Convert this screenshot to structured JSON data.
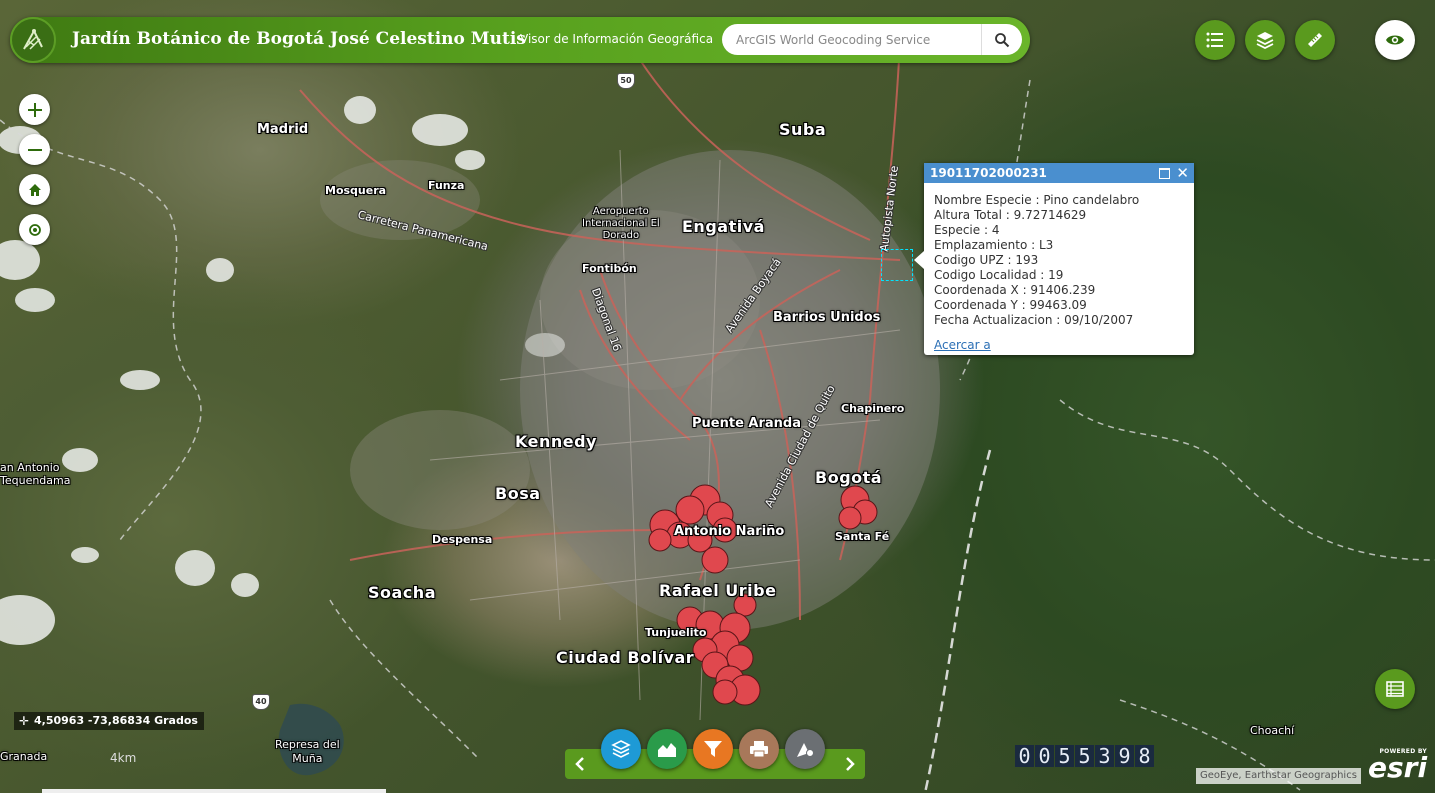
{
  "header": {
    "title": "Jardín Botánico de Bogotá José Celestino Mutis",
    "subtitle": "Visor de Información Geográfica",
    "search_placeholder": "ArcGIS World Geocoding Service"
  },
  "top_right_buttons": [
    "list-icon",
    "layers-icon",
    "measure-icon",
    "eye-icon"
  ],
  "map_controls": [
    "zoom-in",
    "zoom-out",
    "home",
    "locate"
  ],
  "place_labels": {
    "madrid": "Madrid",
    "suba": "Suba",
    "mosquera": "Mosquera",
    "funza": "Funza",
    "engativa": "Engativá",
    "aeropuerto": "Aeropuerto\nInternacional El\nDorado",
    "fontibon": "Fontibón",
    "barrios_unidos": "Barrios Unidos",
    "kennedy": "Kennedy",
    "puente_aranda": "Puente Aranda",
    "chapinero": "Chapinero",
    "bogota": "Bogotá",
    "bosa": "Bosa",
    "antonio_narino": "Antonio Nariño",
    "santa_fe": "Santa Fé",
    "despensa": "Despensa",
    "soacha": "Soacha",
    "rafael_uribe": "Rafael Uribe",
    "tunjuelito": "Tunjuelito",
    "ciudad_bolivar": "Ciudad Bolívar",
    "san_antonio": "an Antonio\nTequendama",
    "granada": "Granada",
    "represa": "Represa del\nMuña",
    "choachi": "Choachí"
  },
  "road_labels": {
    "carretera": "Carretera Panamericana",
    "diagonal": "Diagonal 16",
    "boyaca": "Avenida Boyacá",
    "ciudad_quito": "Avenida Ciudad de Quito",
    "autopista": "Autopista Norte"
  },
  "road_shields": [
    "50",
    "40"
  ],
  "popup": {
    "title": "19011702000231",
    "fields": [
      "Nombre Especie : Pino candelabro",
      "Altura Total : 9.72714629",
      "Especie : 4",
      "Emplazamiento : L3",
      "Codigo UPZ : 193",
      "Codigo Localidad : 19",
      "Coordenada X : 91406.239",
      "Coordenada Y : 99463.09",
      "Fecha Actualizacion : 09/10/2007"
    ],
    "zoom_link": "Acercar a"
  },
  "coordinates": "4,50963 -73,86834 Grados",
  "scale_label": "4km",
  "counter_digits": [
    "0",
    "0",
    "5",
    "5",
    "3",
    "9",
    "8"
  ],
  "attribution": "GeoEye, Earthstar Geographics",
  "esri": {
    "powered": "POWERED BY",
    "logo": "esri"
  },
  "bottom_tools": [
    "layers-tool",
    "chart-tool",
    "filter-tool",
    "print-tool",
    "draw-tool"
  ],
  "colors": {
    "header_green": "#5a9a1e",
    "popup_header": "#4a8fcf",
    "tree_points": "#e0484e",
    "tool_blue": "#1e9ad6",
    "tool_green": "#2a9b4a",
    "tool_orange": "#e87722",
    "tool_brown": "#a8785a",
    "tool_gray": "#6b6f73"
  }
}
